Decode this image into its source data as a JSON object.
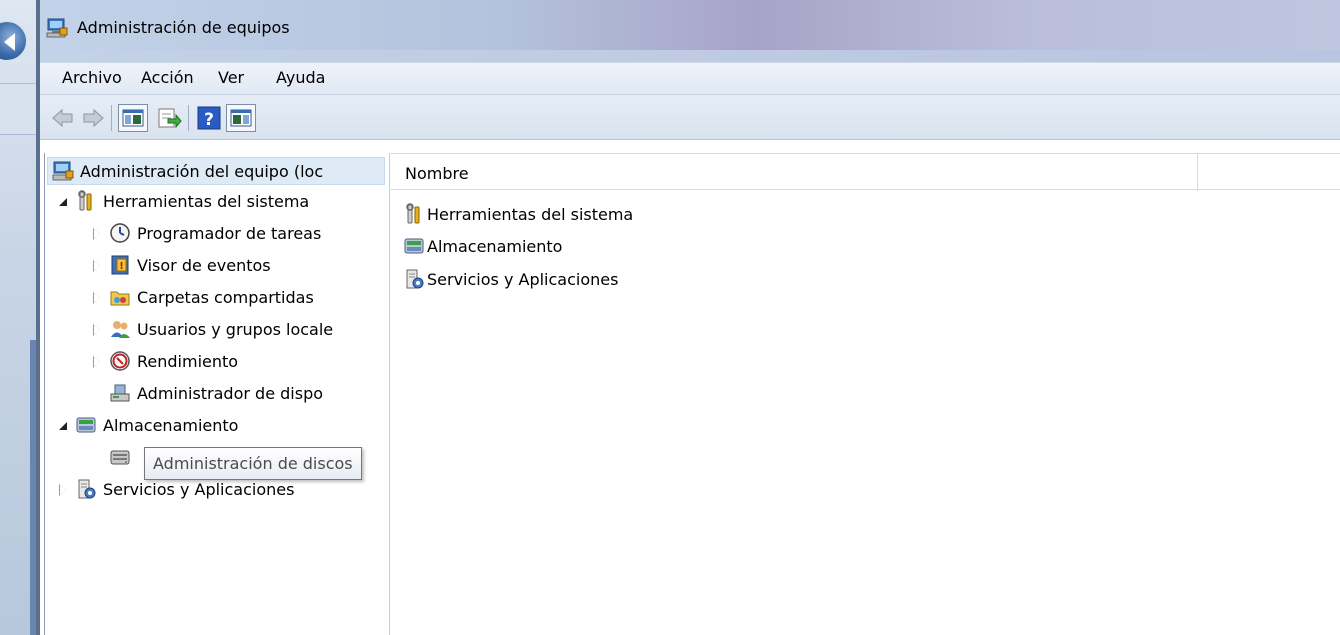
{
  "window": {
    "title": "Administración de equipos"
  },
  "menu": [
    "Archivo",
    "Acción",
    "Ver",
    "Ayuda"
  ],
  "toolbar": {
    "buttons": [
      "back-arrow-icon",
      "forward-arrow-icon",
      "show-hide-console-tree-icon",
      "export-list-icon",
      "help-icon",
      "show-hide-action-pane-icon"
    ]
  },
  "tree": {
    "root": "Administración del equipo (loc",
    "system_tools": "Herramientas del sistema",
    "task_scheduler": "Programador de tareas",
    "event_viewer": "Visor de eventos",
    "shared_folders": "Carpetas compartidas",
    "local_users": "Usuarios y grupos locale",
    "performance": "Rendimiento",
    "device_manager": "Administrador de dispo",
    "storage": "Almacenamiento",
    "disk_management": "Administración de discos",
    "services_apps": "Servicios y Aplicaciones"
  },
  "tooltip": {
    "text": "Administración de discos"
  },
  "list": {
    "column_name": "Nombre",
    "items": [
      "Herramientas del sistema",
      "Almacenamiento",
      "Servicios y Aplicaciones"
    ]
  }
}
